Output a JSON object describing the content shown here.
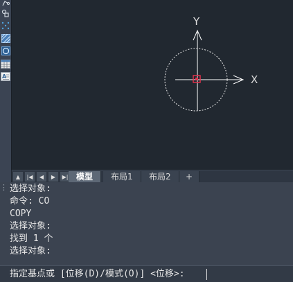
{
  "toolbar": {
    "tools": [
      {
        "icon": "polyline-icon"
      },
      {
        "icon": "revcloud-icon"
      },
      {
        "icon": "spline-icon"
      },
      {
        "icon": "hatch-icon"
      },
      {
        "icon": "circle-icon"
      },
      {
        "icon": "table-icon"
      },
      {
        "icon": "mtext-icon"
      }
    ]
  },
  "canvas": {
    "ucs": {
      "x_label": "X",
      "y_label": "Y"
    },
    "colors": {
      "background": "#212830",
      "axes": "#ffffff",
      "pickbox": "#e0314b"
    }
  },
  "tabs": {
    "nav": [
      "first-icon",
      "prev-icon",
      "next-icon",
      "last-icon"
    ],
    "items": [
      {
        "label": "模型",
        "active": true
      },
      {
        "label": "布局1",
        "active": false
      },
      {
        "label": "布局2",
        "active": false
      },
      {
        "label": "+",
        "active": false
      }
    ]
  },
  "command": {
    "history": [
      "选择对象:",
      "命令: CO",
      "COPY",
      "选择对象:",
      "找到 1 个",
      "选择对象:"
    ],
    "prompt": "指定基点或 [位移(D)/模式(O)] <位移>:"
  }
}
